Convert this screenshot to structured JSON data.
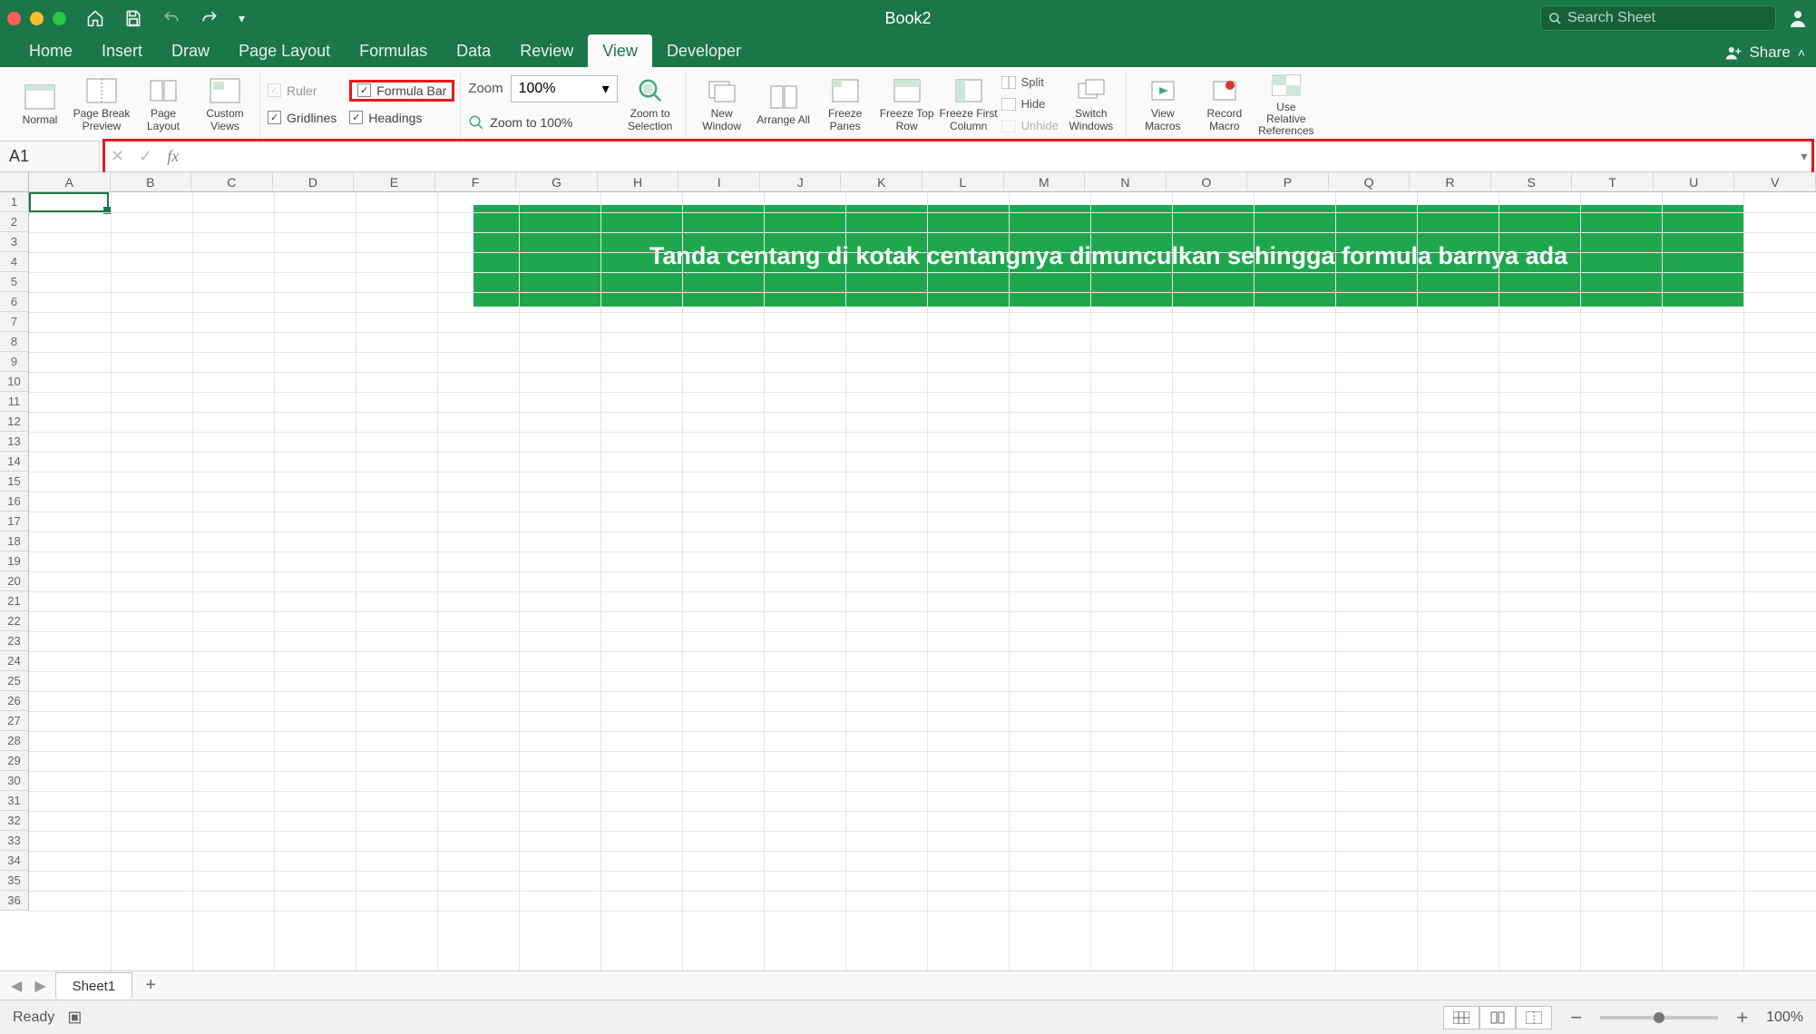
{
  "title": "Book2",
  "search_placeholder": "Search Sheet",
  "ribbon_tabs": [
    "Home",
    "Insert",
    "Draw",
    "Page Layout",
    "Formulas",
    "Data",
    "Review",
    "View",
    "Developer"
  ],
  "active_tab": "View",
  "share": "Share",
  "view_group": {
    "normal": "Normal",
    "pbp": "Page Break Preview",
    "pl": "Page Layout",
    "cv": "Custom Views"
  },
  "show": {
    "ruler": "Ruler",
    "formula_bar": "Formula Bar",
    "gridlines": "Gridlines",
    "headings": "Headings"
  },
  "zoom": {
    "label": "Zoom",
    "value": "100%",
    "to100": "Zoom to 100%",
    "tosel": "Zoom to Selection"
  },
  "window": {
    "new": "New Window",
    "arrange": "Arrange All",
    "fp": "Freeze Panes",
    "ftr": "Freeze Top Row",
    "ffc": "Freeze First Column",
    "split": "Split",
    "hide": "Hide",
    "unhide": "Unhide",
    "switch": "Switch Windows"
  },
  "macros": {
    "view": "View Macros",
    "record": "Record Macro",
    "relref": "Use Relative References"
  },
  "formula_bar": {
    "namebox": "A1"
  },
  "callout": "Tanda centang di kotak centangnya dimunculkan  sehingga formula barnya ada",
  "columns": [
    "A",
    "B",
    "C",
    "D",
    "E",
    "F",
    "G",
    "H",
    "I",
    "J",
    "K",
    "L",
    "M",
    "N",
    "O",
    "P",
    "Q",
    "R",
    "S",
    "T",
    "U",
    "V"
  ],
  "rows": 36,
  "sheet": "Sheet1",
  "status": {
    "ready": "Ready",
    "zoom": "100%"
  }
}
